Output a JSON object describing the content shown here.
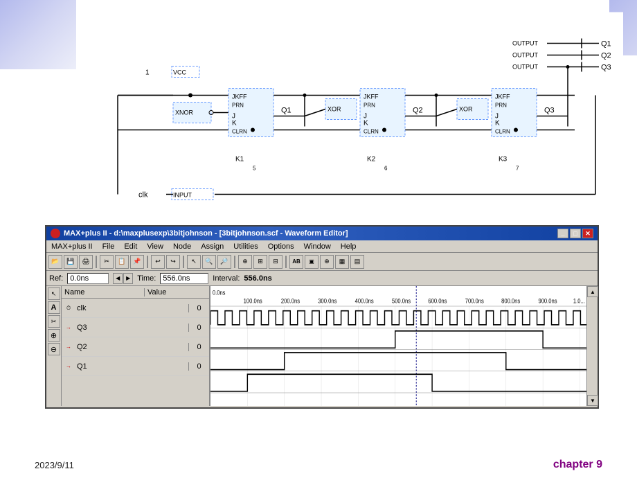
{
  "page": {
    "background": "white",
    "date": "2023/9/11",
    "chapter": "chapter 9"
  },
  "decorative": {
    "top_left_gradient": true,
    "top_right_gradient": true
  },
  "window": {
    "title": "MAX+plus II - d:\\maxplusexp\\3bitjohnson - [3bitjohnson.scf - Waveform Editor]",
    "title_icon": "●",
    "minimize_label": "_",
    "maximize_label": "□",
    "close_label": "✕",
    "secondary_close": "×",
    "menubar_items": [
      "MAX+plus II",
      "File",
      "Edit",
      "View",
      "Node",
      "Assign",
      "Utilities",
      "Options",
      "Window",
      "Help"
    ],
    "ref_label": "Ref:",
    "ref_value": "0.0ns",
    "time_label": "Time:",
    "time_value": "556.0ns",
    "interval_label": "Interval:",
    "interval_value": "556.0ns",
    "cursor_time": "0.0ns"
  },
  "waveform": {
    "header": {
      "name_col": "Name",
      "value_col": "Value"
    },
    "signals": [
      {
        "name": "clk",
        "value": "0",
        "color": "#000000"
      },
      {
        "name": "Q3",
        "value": "0",
        "color": "#cc0000"
      },
      {
        "name": "Q2",
        "value": "0",
        "color": "#cc0000"
      },
      {
        "name": "Q1",
        "value": "0",
        "color": "#cc0000"
      }
    ],
    "time_axis": {
      "labels": [
        "100.0ns",
        "200.0ns",
        "300.0ns",
        "400.0ns",
        "500.0ns",
        "600.0ns",
        "700.0ns",
        "800.0ns",
        "900.0ns",
        "1.0..."
      ]
    }
  },
  "toolbar": {
    "buttons": [
      "open",
      "save",
      "print",
      "cut",
      "copy",
      "paste",
      "undo",
      "redo",
      "pointer",
      "zoom-in",
      "zoom-out",
      "node",
      "add",
      "snap",
      "grid",
      "ab",
      "cd",
      "magnify"
    ]
  },
  "tools": {
    "items": [
      "cursor",
      "text",
      "scissors",
      "zoom-in",
      "zoom-out",
      "plus"
    ]
  }
}
